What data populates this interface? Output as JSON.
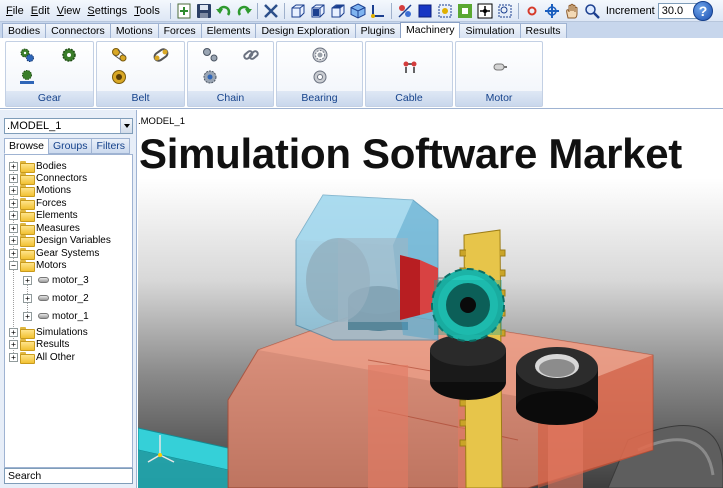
{
  "menu": [
    "File",
    "Edit",
    "View",
    "Settings",
    "Tools"
  ],
  "toolbar": {
    "icons": [
      "new-icon",
      "save-icon",
      "undo-icon",
      "redo-icon",
      "tools-icon",
      "cube-front-icon",
      "cube-side-icon",
      "cube-top-icon",
      "cube-iso-icon",
      "axes-icon",
      "bodies-icon",
      "shade-icon",
      "wire-icon",
      "fit-icon",
      "select-icon",
      "zoom-box-icon",
      "point-icon",
      "rotate-icon",
      "pan-icon",
      "zoom-icon"
    ],
    "increment_label": "Increment",
    "increment_value": "30.0",
    "help": "?"
  },
  "tabs": [
    "Bodies",
    "Connectors",
    "Motions",
    "Forces",
    "Elements",
    "Design Exploration",
    "Plugins",
    "Machinery",
    "Simulation",
    "Results"
  ],
  "active_tab": "Machinery",
  "ribbon_groups": [
    {
      "label": "Gear",
      "icons": [
        "gear-pair-icon",
        "gear-icon",
        "gear-rack-icon"
      ]
    },
    {
      "label": "Belt",
      "icons": [
        "belt-pulley-icon",
        "belt-icon",
        "pulley-icon"
      ]
    },
    {
      "label": "Chain",
      "icons": [
        "chain-sprocket-icon",
        "chain-icon",
        "sprocket-icon"
      ]
    },
    {
      "label": "Bearing",
      "icons": [
        "bearing-icon",
        "bearing-housing-icon"
      ]
    },
    {
      "label": "Cable",
      "icons": [
        "cable-icon"
      ]
    },
    {
      "label": "Motor",
      "icons": [
        "motor-icon"
      ]
    }
  ],
  "left_panel": {
    "model_selector": ".MODEL_1",
    "browser_tabs": [
      "Browse",
      "Groups",
      "Filters"
    ],
    "active_browser_tab": "Browse",
    "tree": [
      {
        "label": "Bodies",
        "expanded": false
      },
      {
        "label": "Connectors",
        "expanded": false
      },
      {
        "label": "Motions",
        "expanded": false
      },
      {
        "label": "Forces",
        "expanded": false
      },
      {
        "label": "Elements",
        "expanded": false
      },
      {
        "label": "Measures",
        "expanded": false
      },
      {
        "label": "Design Variables",
        "expanded": false
      },
      {
        "label": "Gear Systems",
        "expanded": false
      },
      {
        "label": "Motors",
        "expanded": true,
        "children": [
          "motor_3",
          "motor_2",
          "motor_1"
        ]
      },
      {
        "label": "Simulations",
        "expanded": false
      },
      {
        "label": "Results",
        "expanded": false
      },
      {
        "label": "All Other",
        "expanded": false
      }
    ],
    "search_placeholder": "Search"
  },
  "viewport": {
    "model_label": ".MODEL_1",
    "overlay_title": "Simulation Software Market"
  }
}
